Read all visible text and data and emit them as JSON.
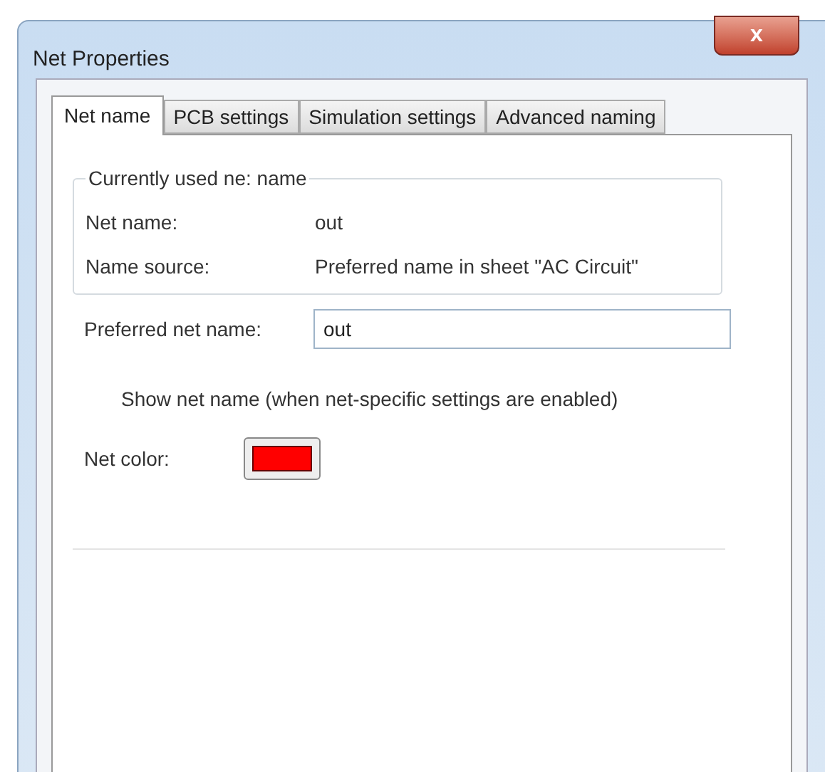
{
  "window": {
    "title": "Net Properties",
    "close_label": "x"
  },
  "tabs": [
    {
      "label": "Net name",
      "selected": true
    },
    {
      "label": "PCB settings",
      "selected": false
    },
    {
      "label": "Simulation settings",
      "selected": false
    },
    {
      "label": "Advanced naming",
      "selected": false
    }
  ],
  "current_group": {
    "title": "Currently used ne: name",
    "rows": [
      {
        "label": "Net name:",
        "value": "out"
      },
      {
        "label": "Name source:",
        "value": "Preferred name in sheet \"AC Circuit\""
      }
    ]
  },
  "preferred": {
    "label": "Preferred net name:",
    "value": "out"
  },
  "show_net_name": {
    "label": "Show net name (when net-specific settings are enabled)"
  },
  "net_color": {
    "label": "Net color:",
    "color": "#ff0000"
  }
}
